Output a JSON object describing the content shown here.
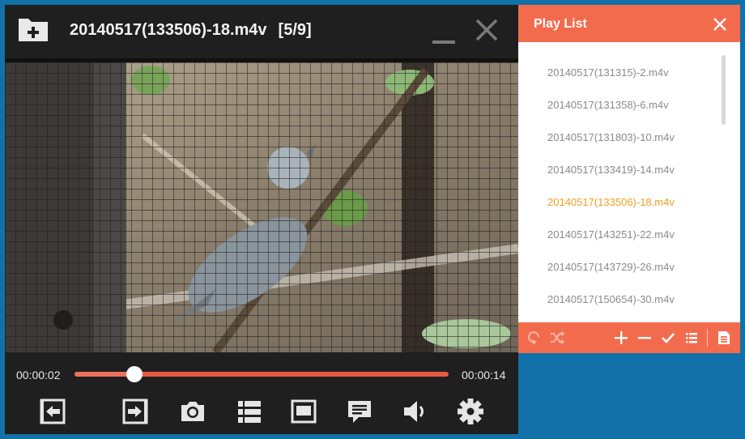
{
  "window": {
    "title": "20140517(133506)-18.m4v",
    "index": "[5/9]"
  },
  "controls": {
    "time_current": "00:00:02",
    "time_total": "00:00:14",
    "progress_fraction": 0.16,
    "buttons": [
      "previous-icon",
      "next-icon",
      "camera-icon",
      "list-icon",
      "screen-icon",
      "chat-icon",
      "volume-icon",
      "gear-icon"
    ]
  },
  "playlist": {
    "title": "Play List",
    "items": [
      "20140517(131315)-2.m4v",
      "20140517(131358)-6.m4v",
      "20140517(131803)-10.m4v",
      "20140517(133419)-14.m4v",
      "20140517(133506)-18.m4v",
      "20140517(143251)-22.m4v",
      "20140517(143729)-26.m4v",
      "20140517(150654)-30.m4v"
    ],
    "active_index": 4,
    "footer_icons": [
      "repeat-icon",
      "shuffle-icon",
      "add-icon",
      "remove-icon",
      "check-icon",
      "list-icon",
      "document-icon"
    ]
  },
  "colors": {
    "accent": "#f36b4d",
    "active_item": "#f0a020",
    "background": "#1271a8",
    "player_bg": "#1f1f1f"
  }
}
